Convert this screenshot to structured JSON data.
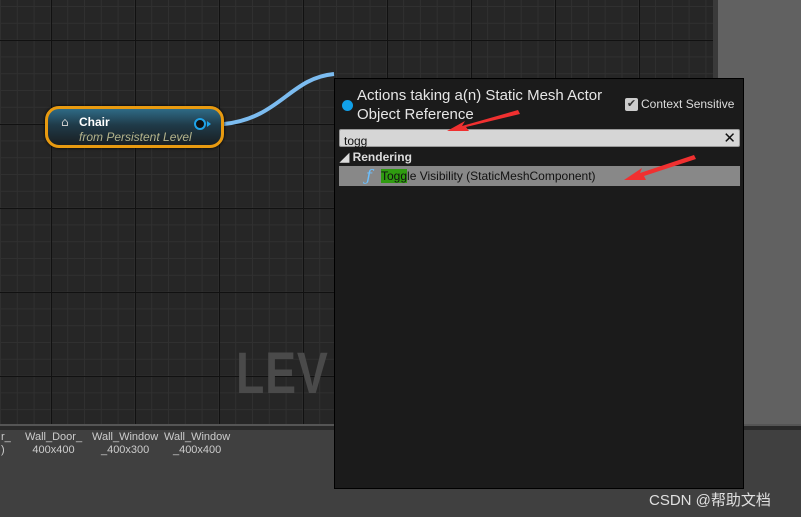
{
  "graph": {
    "watermark": "LEV"
  },
  "node": {
    "title": "Chair",
    "subtitle": "from Persistent Level",
    "icon": "home-icon",
    "border_color": "#e89a10",
    "pin_color": "#1fa3e8"
  },
  "assets": [
    {
      "label": "r_\n)"
    },
    {
      "label": "Wall_Door_\n400x400"
    },
    {
      "label": "Wall_Window\n_400x300"
    },
    {
      "label": "Wall_Window\n_400x400"
    }
  ],
  "popup": {
    "title": "Actions taking a(n) Static Mesh Actor Object Reference",
    "context_sensitive_label": "Context Sensitive",
    "context_sensitive_checked": true,
    "search_value": "togg",
    "category": "Rendering",
    "item_highlight": "Togg",
    "item_rest": "le Visibility (StaticMeshComponent)",
    "highlight_color": "#2f9b10"
  },
  "watermark": "CSDN @帮助文档"
}
